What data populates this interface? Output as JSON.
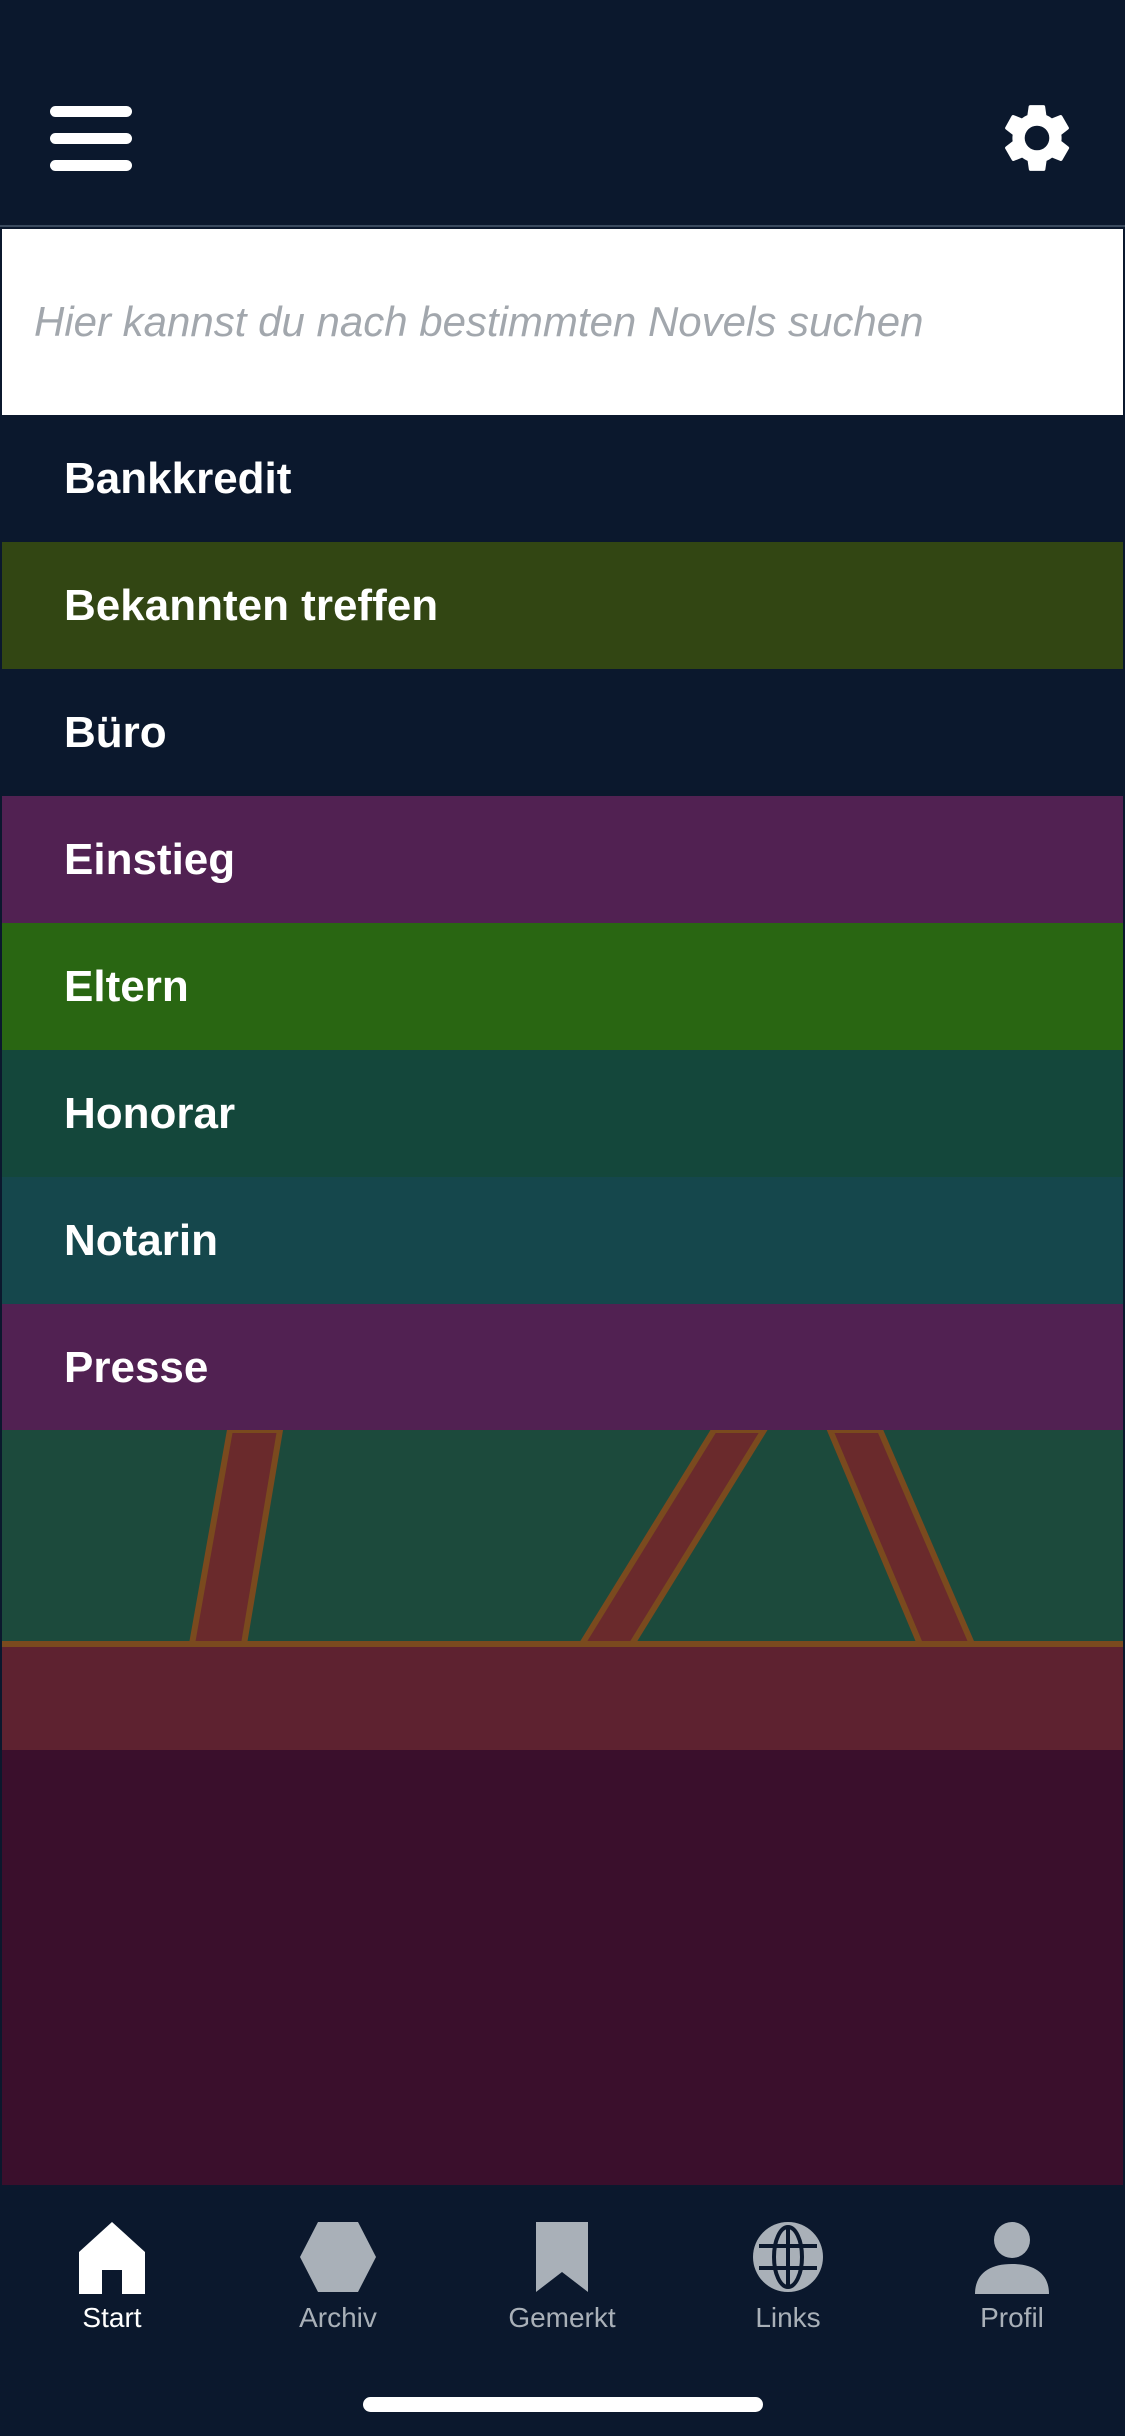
{
  "header": {
    "menu_icon": "hamburger-menu-icon",
    "settings_icon": "gear-icon"
  },
  "search": {
    "placeholder": "Hier kannst du nach bestimmten Novels suchen",
    "value": ""
  },
  "novels": [
    {
      "label": "Bankkredit",
      "color": "#0b182d"
    },
    {
      "label": "Bekannten treffen",
      "color": "#324613"
    },
    {
      "label": "Büro",
      "color": "#0b182d"
    },
    {
      "label": "Einstieg",
      "color": "#512152"
    },
    {
      "label": "Eltern",
      "color": "#296612"
    },
    {
      "label": "Honorar",
      "color": "#14473b"
    },
    {
      "label": "Notarin",
      "color": "#15474c"
    },
    {
      "label": "Presse",
      "color": "#512152"
    }
  ],
  "tabbar": {
    "tabs": [
      {
        "label": "Start",
        "icon": "home-icon",
        "active": true
      },
      {
        "label": "Archiv",
        "icon": "hexagon-icon",
        "active": false
      },
      {
        "label": "Gemerkt",
        "icon": "bookmark-icon",
        "active": false
      },
      {
        "label": "Links",
        "icon": "globe-icon",
        "active": false
      },
      {
        "label": "Profil",
        "icon": "person-icon",
        "active": false
      }
    ]
  },
  "colors": {
    "navy": "#0b182d",
    "illustration_green": "#1c4a3c",
    "illustration_red": "#5e2230",
    "illustration_outline": "#7a4a1e",
    "illustration_dark": "#3a0f2c",
    "tab_inactive": "#a9b0b8",
    "tab_active": "#ffffff"
  }
}
